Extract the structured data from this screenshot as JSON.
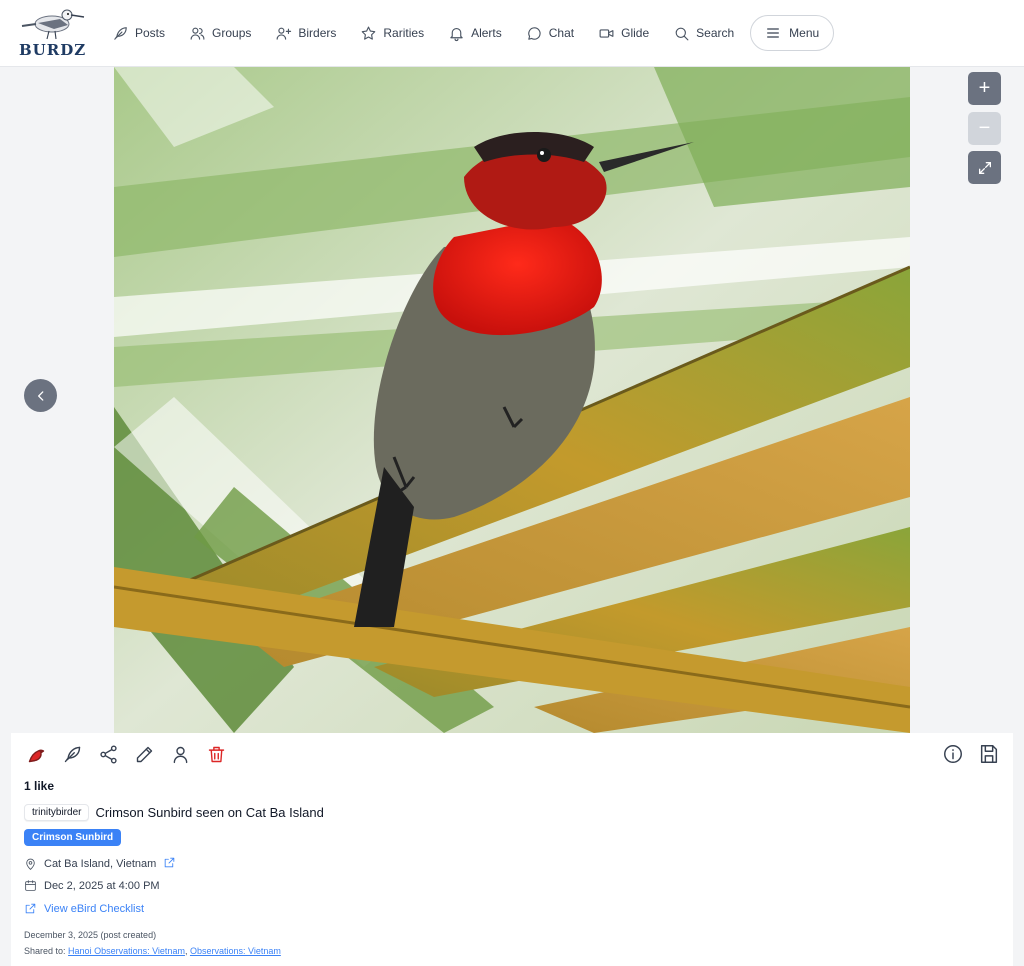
{
  "header": {
    "logo_text": "BURDZ",
    "nav": [
      {
        "label": "Posts",
        "icon": "feather-icon"
      },
      {
        "label": "Groups",
        "icon": "users-icon"
      },
      {
        "label": "Birders",
        "icon": "user-plus-icon"
      },
      {
        "label": "Rarities",
        "icon": "star-icon"
      },
      {
        "label": "Alerts",
        "icon": "bell-icon"
      },
      {
        "label": "Chat",
        "icon": "chat-bubble-icon"
      },
      {
        "label": "Glide",
        "icon": "video-icon"
      },
      {
        "label": "Search",
        "icon": "search-icon"
      }
    ],
    "menu_label": "Menu"
  },
  "viewer": {
    "zoom_in_symbol": "+",
    "zoom_out_symbol": "−"
  },
  "post": {
    "likes": "1 like",
    "username": "trinitybirder",
    "caption": "Crimson Sunbird seen on Cat Ba Island",
    "species_tag": "Crimson Sunbird",
    "location": "Cat Ba Island, Vietnam",
    "datetime": "Dec 2, 2025 at 4:00 PM",
    "ebird_link": "View eBird Checklist",
    "created": "December 3, 2025 (post created)",
    "shared_prefix": "Shared to:",
    "shared_groups": [
      "Hanoi Observations: Vietnam",
      "Observations: Vietnam"
    ]
  },
  "colors": {
    "accent_blue": "#3b82f6",
    "delete_red": "#dc2626",
    "like_red": "#dc2626",
    "control_gray": "#6b7280"
  }
}
